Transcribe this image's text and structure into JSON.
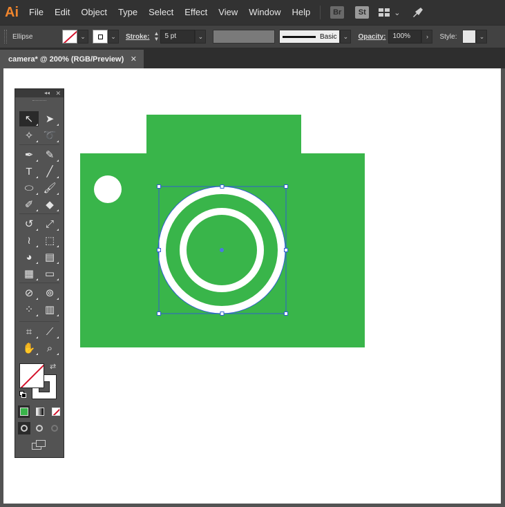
{
  "app": {
    "logo": "Ai"
  },
  "menu": [
    "File",
    "Edit",
    "Object",
    "Type",
    "Select",
    "Effect",
    "View",
    "Window",
    "Help"
  ],
  "menubar_right": {
    "bridge": "Br",
    "stock": "St",
    "workspace_icon": "grid-icon",
    "rocket_icon": "rocket-icon"
  },
  "control": {
    "selection_type": "Ellipse",
    "stroke_label": "Stroke:",
    "stroke_value": "5 pt",
    "brush_label": "Basic",
    "opacity_label": "Opacity:",
    "opacity_value": "100%",
    "style_label": "Style:"
  },
  "document": {
    "tab_title": "camera* @ 200% (RGB/Preview)",
    "close_glyph": "✕"
  },
  "colors": {
    "accent_green": "#39b54a",
    "selection_blue": "#2f5fd0",
    "canvas": "#ffffff",
    "chrome": "#535353"
  },
  "tools": {
    "collapse_glyph": "◂◂",
    "close_glyph": "✕",
    "items": [
      {
        "name": "selection-tool",
        "glyph": "↖"
      },
      {
        "name": "direct-selection-tool",
        "glyph": "➤"
      },
      {
        "name": "magic-wand-tool",
        "glyph": "✧"
      },
      {
        "name": "lasso-tool",
        "glyph": "➰"
      },
      {
        "name": "pen-tool",
        "glyph": "✒"
      },
      {
        "name": "curvature-tool",
        "glyph": "✎"
      },
      {
        "name": "type-tool",
        "glyph": "T"
      },
      {
        "name": "line-tool",
        "glyph": "╱"
      },
      {
        "name": "ellipse-tool",
        "glyph": "⬭"
      },
      {
        "name": "paintbrush-tool",
        "glyph": "🖌"
      },
      {
        "name": "shaper-tool",
        "glyph": "✐"
      },
      {
        "name": "eraser-tool",
        "glyph": "◆"
      },
      {
        "name": "rotate-tool",
        "glyph": "↺"
      },
      {
        "name": "scale-tool",
        "glyph": "⤢"
      },
      {
        "name": "width-tool",
        "glyph": "≀"
      },
      {
        "name": "free-transform-tool",
        "glyph": "⬚"
      },
      {
        "name": "shape-builder-tool",
        "glyph": "◕"
      },
      {
        "name": "perspective-grid-tool",
        "glyph": "▤"
      },
      {
        "name": "mesh-tool",
        "glyph": "▦"
      },
      {
        "name": "gradient-tool",
        "glyph": "▭"
      },
      {
        "name": "eyedropper-tool",
        "glyph": "⊘"
      },
      {
        "name": "blend-tool",
        "glyph": "⊚"
      },
      {
        "name": "symbol-sprayer-tool",
        "glyph": "⁘"
      },
      {
        "name": "column-graph-tool",
        "glyph": "▥"
      },
      {
        "name": "artboard-tool",
        "glyph": "⌗"
      },
      {
        "name": "slice-tool",
        "glyph": "⟋"
      },
      {
        "name": "hand-tool",
        "glyph": "✋"
      },
      {
        "name": "zoom-tool",
        "glyph": "⌕"
      }
    ],
    "swap_glyph": "⇄",
    "mode_buttons": [
      "color-mode-icon",
      "gradient-mode-icon",
      "none-mode-icon"
    ],
    "draw_modes": [
      "draw-normal-icon",
      "draw-behind-icon",
      "draw-inside-icon"
    ],
    "screen_mode": "screen-mode-icon"
  }
}
